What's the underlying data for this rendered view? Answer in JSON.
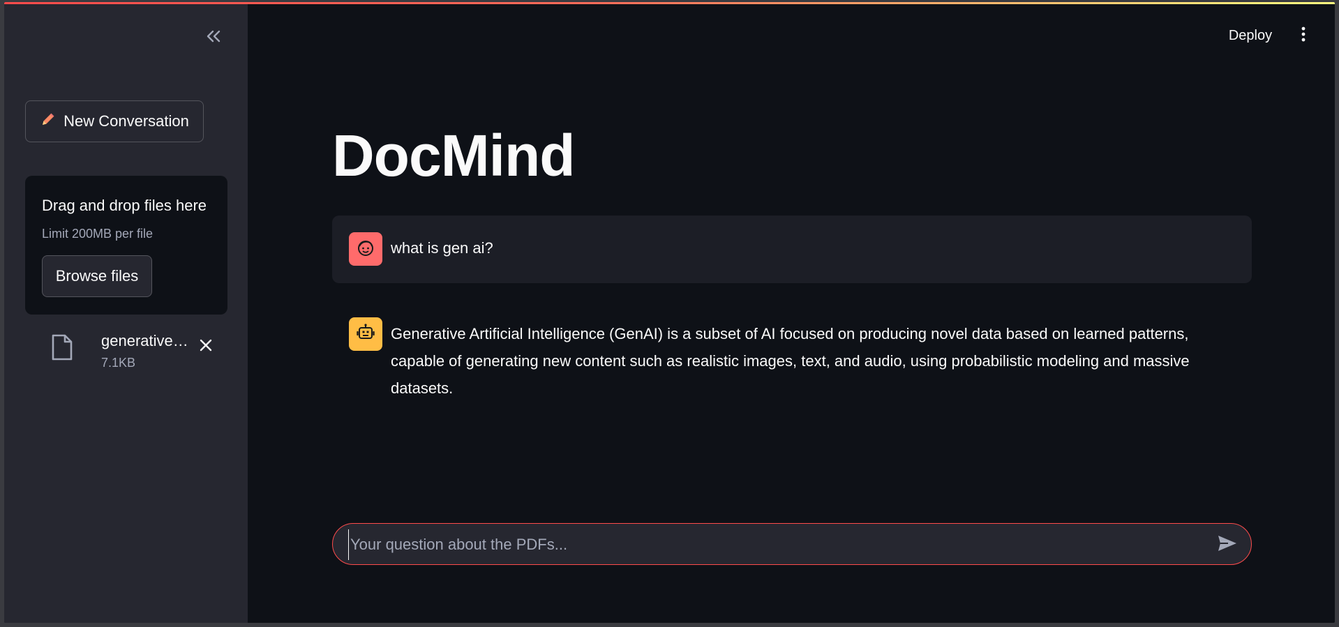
{
  "sidebar": {
    "new_conversation_label": "New Conversation",
    "uploader": {
      "title": "Drag and drop files here",
      "limit": "Limit 200MB per file",
      "browse_label": "Browse files"
    },
    "file": {
      "name": "generative…",
      "size": "7.1KB"
    }
  },
  "header": {
    "deploy_label": "Deploy"
  },
  "main": {
    "title": "DocMind",
    "messages": [
      {
        "role": "user",
        "text": "what is gen ai?"
      },
      {
        "role": "assistant",
        "text": "Generative Artificial Intelligence (GenAI) is a subset of AI focused on producing novel data based on learned patterns, capable of generating new content such as realistic images, text, and audio, using probabilistic modeling and massive datasets."
      }
    ],
    "input": {
      "placeholder": "Your question about the PDFs...",
      "value": ""
    }
  },
  "icons": {
    "collapse": "double-chevron-left-icon",
    "pencil": "pencil-icon",
    "file": "file-icon",
    "close": "close-icon",
    "menu": "kebab-menu-icon",
    "user_avatar": "user-face-icon",
    "assistant_avatar": "robot-icon",
    "send": "send-icon"
  },
  "colors": {
    "accent": "#ff4b4b",
    "user_avatar_bg": "#ff6b6b",
    "assistant_avatar_bg": "#ffbd45",
    "sidebar_bg": "#262730",
    "main_bg": "#0e1117"
  }
}
